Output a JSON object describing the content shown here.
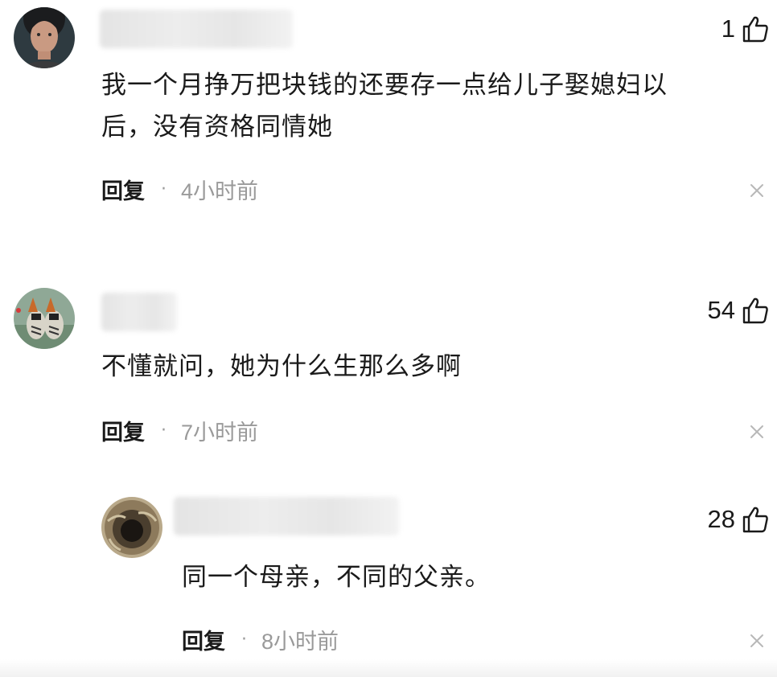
{
  "comments": [
    {
      "avatar_icon": "man-portrait-avatar",
      "likes": "1",
      "content_line1": "我一个月挣万把块钱的还要存一点给儿子娶媳妇以",
      "content_line2": "后，没有资格同情她",
      "reply_label": "回复",
      "separator": "·",
      "time": "4小时前"
    },
    {
      "avatar_icon": "bird-avatar",
      "likes": "54",
      "content_line1": "不懂就问，她为什么生那么多啊",
      "reply_label": "回复",
      "separator": "·",
      "time": "7小时前",
      "reply": {
        "avatar_icon": "well-avatar",
        "likes": "28",
        "content_line1": "同一个母亲，不同的父亲。",
        "reply_label": "回复",
        "separator": "·",
        "time": "8小时前"
      }
    }
  ],
  "icons": {
    "like": "thumbs-up-icon",
    "dismiss": "close-icon"
  },
  "colors": {
    "text": "#1a1a1a",
    "muted": "#9a9a9a",
    "background": "#ffffff"
  }
}
